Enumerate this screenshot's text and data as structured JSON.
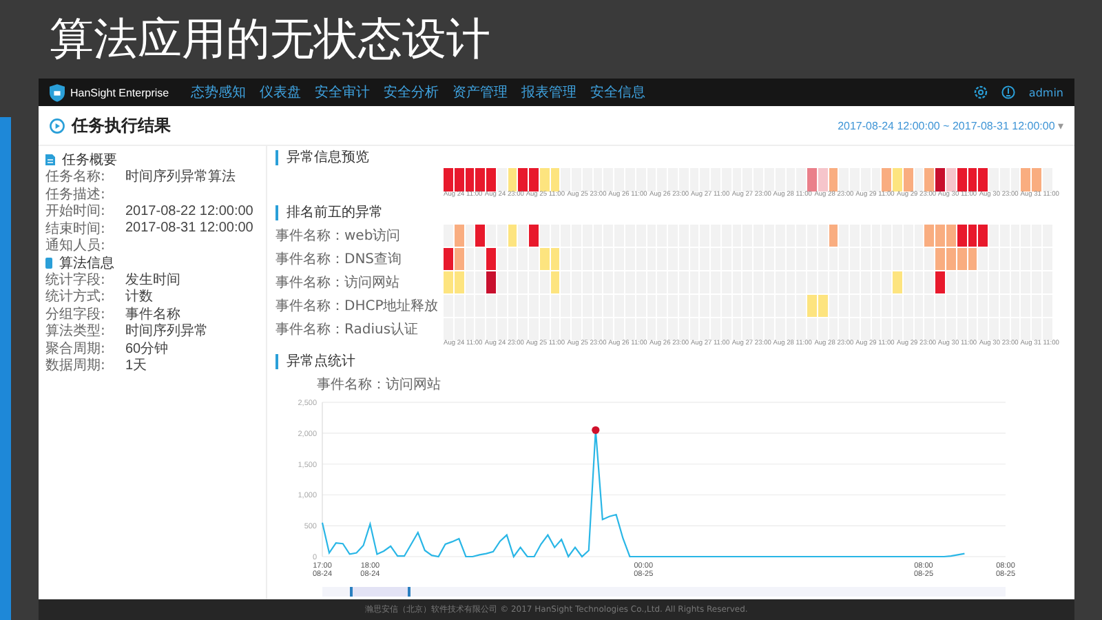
{
  "slide": {
    "title": "算法应用的无状态设计"
  },
  "nav": {
    "brand": "HanSight Enterprise",
    "items": [
      "态势感知",
      "仪表盘",
      "安全审计",
      "安全分析",
      "资产管理",
      "报表管理",
      "安全信息"
    ],
    "user": "admin"
  },
  "header": {
    "title": "任务执行结果",
    "date_range": "2017-08-24 12:00:00 ~ 2017-08-31 12:00:00",
    "caret": "▾"
  },
  "sections": [
    {
      "title": "任务概要",
      "kind": "doc",
      "rows": [
        {
          "label": "任务名称:",
          "value": "时间序列异常算法"
        },
        {
          "label": "任务描述:"
        },
        {
          "label": "开始时间:",
          "value": "2017-08-22 12:00:00"
        },
        {
          "label": "结束时间:",
          "value": "2017-08-31 12:00:00"
        },
        {
          "label": "通知人员:"
        }
      ]
    },
    {
      "title": "算法信息",
      "kind": "bar",
      "rows": [
        {
          "label": "统计字段:",
          "value": "发生时间"
        },
        {
          "label": "统计方式:",
          "value": "计数"
        },
        {
          "label": "分组字段:",
          "value": "事件名称"
        },
        {
          "label": "算法类型:",
          "value": "时间序列异常"
        },
        {
          "label": "聚合周期:",
          "value": "60分钟"
        },
        {
          "label": "数据周期:",
          "value": "1天"
        }
      ]
    }
  ],
  "overview": {
    "title": "异常信息预览",
    "cells": [
      {
        "color": "#e8192c"
      },
      {
        "color": "#e8192c"
      },
      {
        "color": "#e8192c"
      },
      {
        "color": "#e8192c"
      },
      {
        "color": "#e8192c"
      },
      {
        "color": "#f2f2f2"
      },
      {
        "color": "#fde47f"
      },
      {
        "color": "#e8192c"
      },
      {
        "color": "#e8192c"
      },
      {
        "color": "#fde47f"
      },
      {
        "color": "#fde47f"
      },
      {
        "color": "#f2f2f2"
      },
      {
        "color": "#f2f2f2"
      },
      {
        "color": "#f2f2f2"
      },
      {
        "color": "#f2f2f2"
      },
      {
        "color": "#f2f2f2"
      },
      {
        "color": "#f2f2f2"
      },
      {
        "color": "#f2f2f2"
      },
      {
        "color": "#f2f2f2"
      },
      {
        "color": "#f2f2f2"
      },
      {
        "color": "#f2f2f2"
      },
      {
        "color": "#f2f2f2"
      },
      {
        "color": "#f2f2f2"
      },
      {
        "color": "#f2f2f2"
      },
      {
        "color": "#f2f2f2"
      },
      {
        "color": "#f2f2f2"
      },
      {
        "color": "#f2f2f2"
      },
      {
        "color": "#f2f2f2"
      },
      {
        "color": "#f2f2f2"
      },
      {
        "color": "#f2f2f2"
      },
      {
        "color": "#f2f2f2"
      },
      {
        "color": "#f2f2f2"
      },
      {
        "color": "#f2f2f2"
      },
      {
        "color": "#f2f2f2"
      },
      {
        "color": "#ea7f8a"
      },
      {
        "color": "#f6c5cb"
      },
      {
        "color": "#f9ad80"
      },
      {
        "color": "#f2f2f2"
      },
      {
        "color": "#f2f2f2"
      },
      {
        "color": "#f2f2f2"
      },
      {
        "color": "#f2f2f2"
      },
      {
        "color": "#f9ad80"
      },
      {
        "color": "#fde47f"
      },
      {
        "color": "#f9ad80"
      },
      {
        "color": "#f2f2f2"
      },
      {
        "color": "#f9ad80"
      },
      {
        "color": "#c8102e"
      },
      {
        "color": "#f6c5cb"
      },
      {
        "color": "#e8192c"
      },
      {
        "color": "#e8192c"
      },
      {
        "color": "#e8192c"
      },
      {
        "color": "#f2f2f2"
      },
      {
        "color": "#f2f2f2"
      },
      {
        "color": "#f2f2f2"
      },
      {
        "color": "#f9ad80"
      },
      {
        "color": "#f9ad80"
      },
      {
        "color": "#f2f2f2"
      }
    ],
    "axis_labels": [
      "Aug 24 11:00",
      "Aug 24 23:00",
      "Aug 25 11:00",
      "Aug 25 23:00",
      "Aug 26 11:00",
      "Aug 26 23:00",
      "Aug 27 11:00",
      "Aug 27 23:00",
      "Aug 28 11:00",
      "Aug 28 23:00",
      "Aug 29 11:00",
      "Aug 29 23:00",
      "Aug 30 11:00",
      "Aug 30 23:00",
      "Aug 31 11:00"
    ]
  },
  "top_five": {
    "title": "排名前五的异常",
    "rows": [
      {
        "label": "事件名称：web访问",
        "cells": [
          {
            "color": "#f2f2f2"
          },
          {
            "color": "#f9ad80"
          },
          {
            "color": "#f2f2f2"
          },
          {
            "color": "#e8192c"
          },
          {
            "color": "#f2f2f2"
          },
          {
            "color": "#f2f2f2"
          },
          {
            "color": "#fde47f"
          },
          {
            "color": "#f2f2f2"
          },
          {
            "color": "#e8192c"
          },
          {
            "color": "#f2f2f2"
          },
          {
            "color": "#f2f2f2"
          },
          {
            "color": "#f2f2f2"
          },
          {
            "color": "#f2f2f2"
          },
          {
            "color": "#f2f2f2"
          },
          {
            "color": "#f2f2f2"
          },
          {
            "color": "#f2f2f2"
          },
          {
            "color": "#f2f2f2"
          },
          {
            "color": "#f2f2f2"
          },
          {
            "color": "#f2f2f2"
          },
          {
            "color": "#f2f2f2"
          },
          {
            "color": "#f2f2f2"
          },
          {
            "color": "#f2f2f2"
          },
          {
            "color": "#f2f2f2"
          },
          {
            "color": "#f2f2f2"
          },
          {
            "color": "#f2f2f2"
          },
          {
            "color": "#f2f2f2"
          },
          {
            "color": "#f2f2f2"
          },
          {
            "color": "#f2f2f2"
          },
          {
            "color": "#f2f2f2"
          },
          {
            "color": "#f2f2f2"
          },
          {
            "color": "#f2f2f2"
          },
          {
            "color": "#f2f2f2"
          },
          {
            "color": "#f2f2f2"
          },
          {
            "color": "#f2f2f2"
          },
          {
            "color": "#f2f2f2"
          },
          {
            "color": "#f2f2f2"
          },
          {
            "color": "#f9ad80"
          },
          {
            "color": "#f2f2f2"
          },
          {
            "color": "#f2f2f2"
          },
          {
            "color": "#f2f2f2"
          },
          {
            "color": "#f2f2f2"
          },
          {
            "color": "#f2f2f2"
          },
          {
            "color": "#f2f2f2"
          },
          {
            "color": "#f2f2f2"
          },
          {
            "color": "#f2f2f2"
          },
          {
            "color": "#f9ad80"
          },
          {
            "color": "#f9ad80"
          },
          {
            "color": "#f9ad80"
          },
          {
            "color": "#e8192c"
          },
          {
            "color": "#e8192c"
          },
          {
            "color": "#e8192c"
          },
          {
            "color": "#f2f2f2"
          },
          {
            "color": "#f2f2f2"
          },
          {
            "color": "#f2f2f2"
          },
          {
            "color": "#f2f2f2"
          },
          {
            "color": "#f2f2f2"
          },
          {
            "color": "#f2f2f2"
          }
        ]
      },
      {
        "label": "事件名称：DNS查询",
        "cells": [
          {
            "color": "#e8192c"
          },
          {
            "color": "#f9ad80"
          },
          {
            "color": "#f2f2f2"
          },
          {
            "color": "#f2f2f2"
          },
          {
            "color": "#e8192c"
          },
          {
            "color": "#f2f2f2"
          },
          {
            "color": "#f2f2f2"
          },
          {
            "color": "#f2f2f2"
          },
          {
            "color": "#f2f2f2"
          },
          {
            "color": "#fde47f"
          },
          {
            "color": "#fde47f"
          },
          {
            "color": "#f2f2f2"
          },
          {
            "color": "#f2f2f2"
          },
          {
            "color": "#f2f2f2"
          },
          {
            "color": "#f2f2f2"
          },
          {
            "color": "#f2f2f2"
          },
          {
            "color": "#f2f2f2"
          },
          {
            "color": "#f2f2f2"
          },
          {
            "color": "#f2f2f2"
          },
          {
            "color": "#f2f2f2"
          },
          {
            "color": "#f2f2f2"
          },
          {
            "color": "#f2f2f2"
          },
          {
            "color": "#f2f2f2"
          },
          {
            "color": "#f2f2f2"
          },
          {
            "color": "#f2f2f2"
          },
          {
            "color": "#f2f2f2"
          },
          {
            "color": "#f2f2f2"
          },
          {
            "color": "#f2f2f2"
          },
          {
            "color": "#f2f2f2"
          },
          {
            "color": "#f2f2f2"
          },
          {
            "color": "#f2f2f2"
          },
          {
            "color": "#f2f2f2"
          },
          {
            "color": "#f2f2f2"
          },
          {
            "color": "#f2f2f2"
          },
          {
            "color": "#f2f2f2"
          },
          {
            "color": "#f2f2f2"
          },
          {
            "color": "#f2f2f2"
          },
          {
            "color": "#f2f2f2"
          },
          {
            "color": "#f2f2f2"
          },
          {
            "color": "#f2f2f2"
          },
          {
            "color": "#f2f2f2"
          },
          {
            "color": "#f2f2f2"
          },
          {
            "color": "#f2f2f2"
          },
          {
            "color": "#f2f2f2"
          },
          {
            "color": "#f2f2f2"
          },
          {
            "color": "#f2f2f2"
          },
          {
            "color": "#f9ad80"
          },
          {
            "color": "#f9ad80"
          },
          {
            "color": "#f9ad80"
          },
          {
            "color": "#f9ad80"
          },
          {
            "color": "#f2f2f2"
          },
          {
            "color": "#f2f2f2"
          },
          {
            "color": "#f2f2f2"
          },
          {
            "color": "#f2f2f2"
          },
          {
            "color": "#f2f2f2"
          },
          {
            "color": "#f2f2f2"
          },
          {
            "color": "#f2f2f2"
          }
        ]
      },
      {
        "label": "事件名称：访问网站",
        "cells": [
          {
            "color": "#fde47f"
          },
          {
            "color": "#fde47f"
          },
          {
            "color": "#f2f2f2"
          },
          {
            "color": "#f2f2f2"
          },
          {
            "color": "#c8102e"
          },
          {
            "color": "#f2f2f2"
          },
          {
            "color": "#f2f2f2"
          },
          {
            "color": "#f2f2f2"
          },
          {
            "color": "#f2f2f2"
          },
          {
            "color": "#f2f2f2"
          },
          {
            "color": "#fde47f"
          },
          {
            "color": "#f2f2f2"
          },
          {
            "color": "#f2f2f2"
          },
          {
            "color": "#f2f2f2"
          },
          {
            "color": "#f2f2f2"
          },
          {
            "color": "#f2f2f2"
          },
          {
            "color": "#f2f2f2"
          },
          {
            "color": "#f2f2f2"
          },
          {
            "color": "#f2f2f2"
          },
          {
            "color": "#f2f2f2"
          },
          {
            "color": "#f2f2f2"
          },
          {
            "color": "#f2f2f2"
          },
          {
            "color": "#f2f2f2"
          },
          {
            "color": "#f2f2f2"
          },
          {
            "color": "#f2f2f2"
          },
          {
            "color": "#f2f2f2"
          },
          {
            "color": "#f2f2f2"
          },
          {
            "color": "#f2f2f2"
          },
          {
            "color": "#f2f2f2"
          },
          {
            "color": "#f2f2f2"
          },
          {
            "color": "#f2f2f2"
          },
          {
            "color": "#f2f2f2"
          },
          {
            "color": "#f2f2f2"
          },
          {
            "color": "#f2f2f2"
          },
          {
            "color": "#f2f2f2"
          },
          {
            "color": "#f2f2f2"
          },
          {
            "color": "#f2f2f2"
          },
          {
            "color": "#f2f2f2"
          },
          {
            "color": "#f2f2f2"
          },
          {
            "color": "#f2f2f2"
          },
          {
            "color": "#f2f2f2"
          },
          {
            "color": "#f2f2f2"
          },
          {
            "color": "#fde47f"
          },
          {
            "color": "#f2f2f2"
          },
          {
            "color": "#f2f2f2"
          },
          {
            "color": "#f2f2f2"
          },
          {
            "color": "#e8192c"
          },
          {
            "color": "#f2f2f2"
          },
          {
            "color": "#f2f2f2"
          },
          {
            "color": "#f2f2f2"
          },
          {
            "color": "#f2f2f2"
          },
          {
            "color": "#f2f2f2"
          },
          {
            "color": "#f2f2f2"
          },
          {
            "color": "#f2f2f2"
          },
          {
            "color": "#f2f2f2"
          },
          {
            "color": "#f2f2f2"
          },
          {
            "color": "#f2f2f2"
          }
        ]
      },
      {
        "label": "事件名称：DHCP地址释放",
        "cells": [
          {
            "color": "#f2f2f2"
          },
          {
            "color": "#f2f2f2"
          },
          {
            "color": "#f2f2f2"
          },
          {
            "color": "#f2f2f2"
          },
          {
            "color": "#f2f2f2"
          },
          {
            "color": "#f2f2f2"
          },
          {
            "color": "#f2f2f2"
          },
          {
            "color": "#f2f2f2"
          },
          {
            "color": "#f2f2f2"
          },
          {
            "color": "#f2f2f2"
          },
          {
            "color": "#f2f2f2"
          },
          {
            "color": "#f2f2f2"
          },
          {
            "color": "#f2f2f2"
          },
          {
            "color": "#f2f2f2"
          },
          {
            "color": "#f2f2f2"
          },
          {
            "color": "#f2f2f2"
          },
          {
            "color": "#f2f2f2"
          },
          {
            "color": "#f2f2f2"
          },
          {
            "color": "#f2f2f2"
          },
          {
            "color": "#f2f2f2"
          },
          {
            "color": "#f2f2f2"
          },
          {
            "color": "#f2f2f2"
          },
          {
            "color": "#f2f2f2"
          },
          {
            "color": "#f2f2f2"
          },
          {
            "color": "#f2f2f2"
          },
          {
            "color": "#f2f2f2"
          },
          {
            "color": "#f2f2f2"
          },
          {
            "color": "#f2f2f2"
          },
          {
            "color": "#f2f2f2"
          },
          {
            "color": "#f2f2f2"
          },
          {
            "color": "#f2f2f2"
          },
          {
            "color": "#f2f2f2"
          },
          {
            "color": "#f2f2f2"
          },
          {
            "color": "#f2f2f2"
          },
          {
            "color": "#fde47f"
          },
          {
            "color": "#fde47f"
          },
          {
            "color": "#f2f2f2"
          },
          {
            "color": "#f2f2f2"
          },
          {
            "color": "#f2f2f2"
          },
          {
            "color": "#f2f2f2"
          },
          {
            "color": "#f2f2f2"
          },
          {
            "color": "#f2f2f2"
          },
          {
            "color": "#f2f2f2"
          },
          {
            "color": "#f2f2f2"
          },
          {
            "color": "#f2f2f2"
          },
          {
            "color": "#f2f2f2"
          },
          {
            "color": "#f2f2f2"
          },
          {
            "color": "#f2f2f2"
          },
          {
            "color": "#f2f2f2"
          },
          {
            "color": "#f2f2f2"
          },
          {
            "color": "#f2f2f2"
          },
          {
            "color": "#f2f2f2"
          },
          {
            "color": "#f2f2f2"
          },
          {
            "color": "#f2f2f2"
          },
          {
            "color": "#f2f2f2"
          },
          {
            "color": "#f2f2f2"
          },
          {
            "color": "#f2f2f2"
          }
        ]
      },
      {
        "label": "事件名称：Radius认证",
        "cells": [
          {
            "color": "#f2f2f2"
          },
          {
            "color": "#f2f2f2"
          },
          {
            "color": "#f2f2f2"
          },
          {
            "color": "#f2f2f2"
          },
          {
            "color": "#f2f2f2"
          },
          {
            "color": "#f2f2f2"
          },
          {
            "color": "#f2f2f2"
          },
          {
            "color": "#f2f2f2"
          },
          {
            "color": "#f2f2f2"
          },
          {
            "color": "#f2f2f2"
          },
          {
            "color": "#f2f2f2"
          },
          {
            "color": "#f2f2f2"
          },
          {
            "color": "#f2f2f2"
          },
          {
            "color": "#f2f2f2"
          },
          {
            "color": "#f2f2f2"
          },
          {
            "color": "#f2f2f2"
          },
          {
            "color": "#f2f2f2"
          },
          {
            "color": "#f2f2f2"
          },
          {
            "color": "#f2f2f2"
          },
          {
            "color": "#f2f2f2"
          },
          {
            "color": "#f2f2f2"
          },
          {
            "color": "#f2f2f2"
          },
          {
            "color": "#f2f2f2"
          },
          {
            "color": "#f2f2f2"
          },
          {
            "color": "#f2f2f2"
          },
          {
            "color": "#f2f2f2"
          },
          {
            "color": "#f2f2f2"
          },
          {
            "color": "#f2f2f2"
          },
          {
            "color": "#f2f2f2"
          },
          {
            "color": "#f2f2f2"
          },
          {
            "color": "#f2f2f2"
          },
          {
            "color": "#f2f2f2"
          },
          {
            "color": "#f2f2f2"
          },
          {
            "color": "#f2f2f2"
          },
          {
            "color": "#f2f2f2"
          },
          {
            "color": "#f2f2f2"
          },
          {
            "color": "#f2f2f2"
          },
          {
            "color": "#f2f2f2"
          },
          {
            "color": "#f2f2f2"
          },
          {
            "color": "#f2f2f2"
          },
          {
            "color": "#f2f2f2"
          },
          {
            "color": "#f2f2f2"
          },
          {
            "color": "#f2f2f2"
          },
          {
            "color": "#f2f2f2"
          },
          {
            "color": "#f2f2f2"
          },
          {
            "color": "#f2f2f2"
          },
          {
            "color": "#f2f2f2"
          },
          {
            "color": "#f2f2f2"
          },
          {
            "color": "#f2f2f2"
          },
          {
            "color": "#f2f2f2"
          },
          {
            "color": "#f2f2f2"
          },
          {
            "color": "#f2f2f2"
          },
          {
            "color": "#f2f2f2"
          },
          {
            "color": "#f2f2f2"
          },
          {
            "color": "#f2f2f2"
          },
          {
            "color": "#f2f2f2"
          },
          {
            "color": "#f2f2f2"
          }
        ]
      }
    ],
    "axis_labels": [
      "Aug 24 11:00",
      "Aug 24 23:00",
      "Aug 25 11:00",
      "Aug 25 23:00",
      "Aug 26 11:00",
      "Aug 26 23:00",
      "Aug 27 11:00",
      "Aug 27 23:00",
      "Aug 28 11:00",
      "Aug 28 23:00",
      "Aug 29 11:00",
      "Aug 29 23:00",
      "Aug 30 11:00",
      "Aug 30 23:00",
      "Aug 31 11:00"
    ]
  },
  "anomaly_stats": {
    "title": "异常点统计",
    "chart_data": {
      "type": "line",
      "title": "事件名称：访问网站",
      "categories": [
        "17:00\n08-24",
        null,
        null,
        null,
        null,
        null,
        null,
        "18:00\n08-24",
        null,
        null,
        null,
        null,
        null,
        null,
        null,
        null,
        null,
        null,
        null,
        null,
        null,
        null,
        null,
        null,
        null,
        null,
        null,
        null,
        null,
        null,
        null,
        null,
        null,
        null,
        null,
        null,
        null,
        null,
        null,
        null,
        null,
        null,
        null,
        null,
        null,
        null,
        null,
        "00:00\n08-25",
        null,
        null,
        null,
        null,
        null,
        null,
        null,
        null,
        null,
        null,
        null,
        null,
        null,
        null,
        null,
        null,
        null,
        null,
        null,
        null,
        null,
        null,
        null,
        null,
        null,
        null,
        null,
        null,
        null,
        null,
        null,
        null,
        null,
        null,
        null,
        null,
        null,
        null,
        null,
        null,
        "08:00\n08-25",
        null,
        null,
        null,
        null,
        null,
        null,
        null,
        null,
        null,
        null,
        null,
        "08:00\n08-25"
      ],
      "values": [
        550,
        60,
        220,
        210,
        40,
        60,
        180,
        530,
        40,
        90,
        170,
        10,
        10,
        200,
        390,
        100,
        20,
        0,
        200,
        240,
        290,
        0,
        0,
        30,
        50,
        80,
        250,
        350,
        0,
        150,
        0,
        0,
        200,
        350,
        150,
        280,
        0,
        150,
        0,
        100,
        2050,
        600,
        650,
        680,
        300,
        0,
        0,
        0,
        0,
        0,
        0,
        0,
        0,
        0,
        0,
        0,
        0,
        0,
        0,
        0,
        0,
        0,
        0,
        0,
        0,
        0,
        0,
        0,
        0,
        0,
        0,
        0,
        0,
        0,
        0,
        0,
        0,
        0,
        0,
        0,
        0,
        0,
        0,
        0,
        0,
        0,
        0,
        0,
        0,
        0,
        0,
        0,
        10,
        30,
        50,
        null,
        null,
        null,
        null,
        null,
        null
      ],
      "ylim": [
        0,
        2500
      ],
      "grid": true,
      "yticks": [
        {
          "value": 0,
          "label": "0"
        },
        {
          "value": 500,
          "label": "500"
        },
        {
          "value": 1000,
          "label": "1,000"
        },
        {
          "value": 1500,
          "label": "1,500"
        },
        {
          "value": 2000,
          "label": "2,000"
        },
        {
          "value": 2500,
          "label": "2,500"
        }
      ]
    },
    "zoom_slider": {
      "level": 0.09
    }
  },
  "footer": "瀚思安信（北京）软件技术有限公司 © 2017 HanSight Technologies Co.,Ltd. All Rights Reserved."
}
